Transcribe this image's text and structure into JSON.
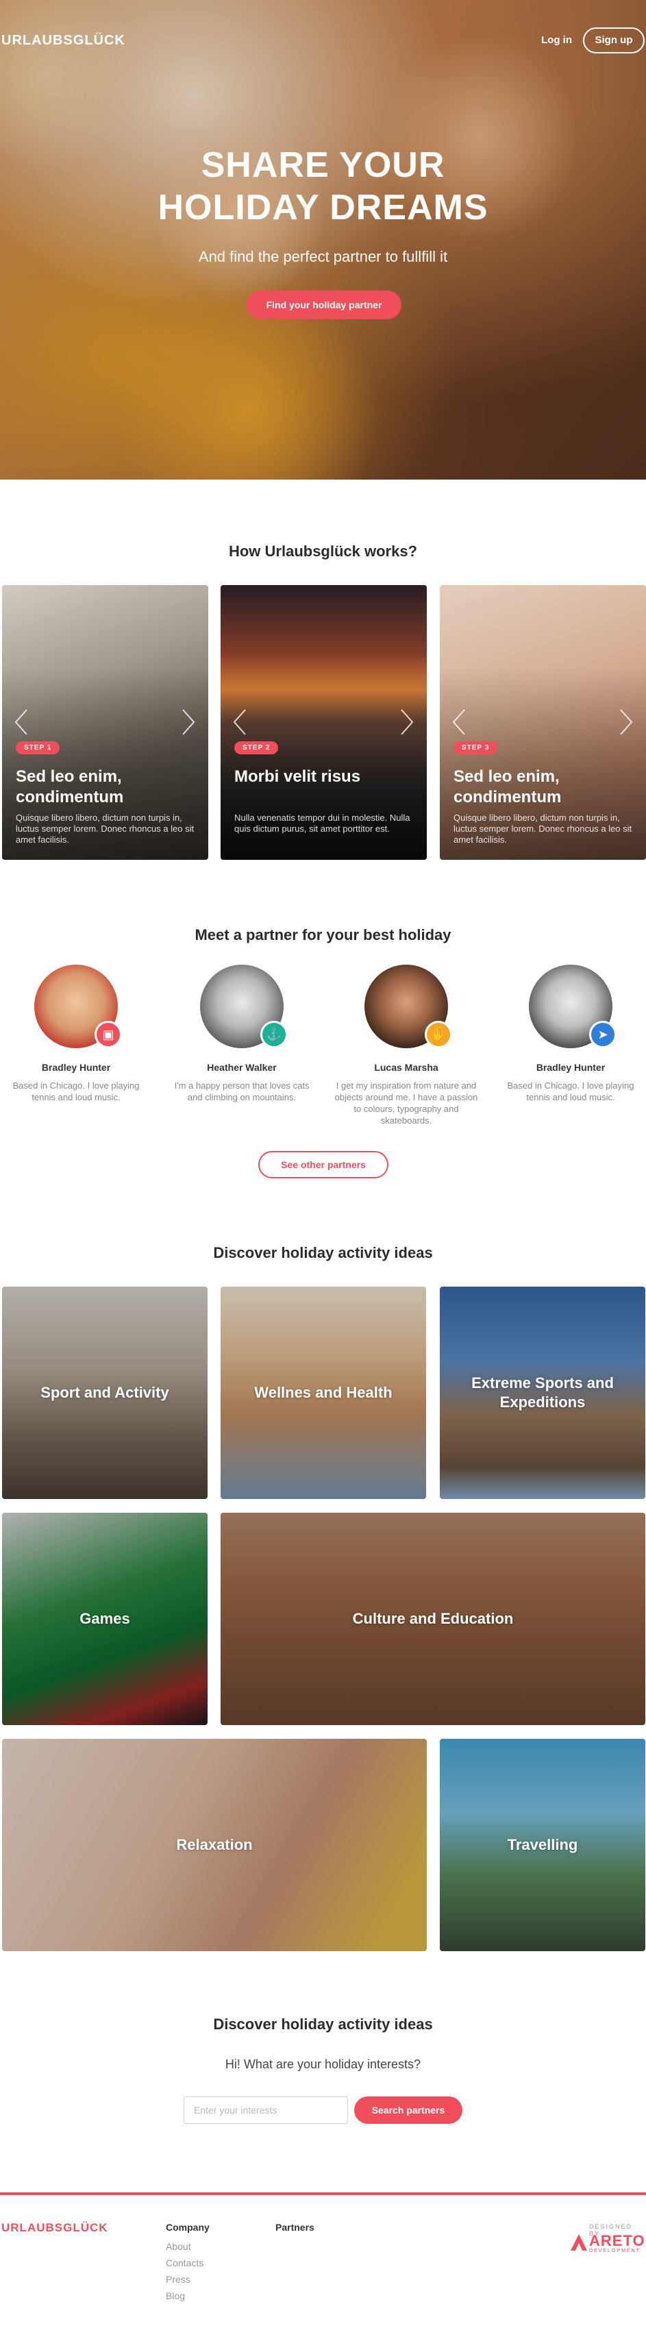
{
  "brand": {
    "logo": "URLAUBSGLÜCK",
    "accent": "#f04e5b"
  },
  "nav": {
    "login": "Log in",
    "signup": "Sign up"
  },
  "hero": {
    "title_line1": "SHARE YOUR",
    "title_line2": "HOLIDAY DREAMS",
    "subtitle": "And find the perfect partner to fullfill it",
    "cta": "Find your holiday partner"
  },
  "how": {
    "title": "How Urlaubsglück works?",
    "steps": [
      {
        "badge": "STEP 1",
        "title": "Sed leo enim, condimentum",
        "text": "Quisque libero libero, dictum non turpis in, luctus semper lorem. Donec rhoncus a leo sit amet facilisis."
      },
      {
        "badge": "STEP 2",
        "title": "Morbi velit risus",
        "text": "Nulla venenatis tempor dui in molestie. Nulla quis dictum purus, sit amet porttitor est."
      },
      {
        "badge": "STEP 3",
        "title": "Sed leo enim, condimentum",
        "text": "Quisque libero libero, dictum non turpis in, luctus semper lorem. Donec rhoncus a leo sit amet facilisis."
      }
    ]
  },
  "partners": {
    "title": "Meet a partner for your best holiday",
    "items": [
      {
        "name": "Bradley Hunter",
        "desc": "Based in Chicago. I love playing tennis and loud music.",
        "badge_color": "#f04e5b",
        "icon": "camera-icon"
      },
      {
        "name": "Heather Walker",
        "desc": "I'm a happy person that loves cats and climbing on mountains.",
        "badge_color": "#19b394",
        "icon": "boat-icon"
      },
      {
        "name": "Lucas Marsha",
        "desc": "I get my inspiration from nature and objects around me. I have a passion to colours, typography and skateboards.",
        "badge_color": "#f5a623",
        "icon": "hand-icon"
      },
      {
        "name": "Bradley Hunter",
        "desc": "Based in Chicago. I love playing tennis and loud music.",
        "badge_color": "#2f7fd8",
        "icon": "plane-icon"
      }
    ],
    "see_more": "See other partners"
  },
  "activities": {
    "title": "Discover holiday activity ideas",
    "items": [
      "Sport and Activity",
      "Wellnes and Health",
      "Extreme Sports and Expeditions",
      "Games",
      "Culture and Education",
      "Relaxation",
      "Travelling"
    ]
  },
  "interests": {
    "title": "Discover holiday activity ideas",
    "subtitle": "Hi! What are your holiday interests?",
    "placeholder": "Enter your interests",
    "button": "Search partners"
  },
  "footer": {
    "logo": "URLAUBSGLÜCK",
    "company_title": "Company",
    "company_links": [
      "About",
      "Contacts",
      "Press",
      "Blog"
    ],
    "partners_title": "Partners",
    "designed_by": "DESIGNED BY",
    "designer": "ARETO",
    "designer_sub": "DEVELOPMENT"
  }
}
